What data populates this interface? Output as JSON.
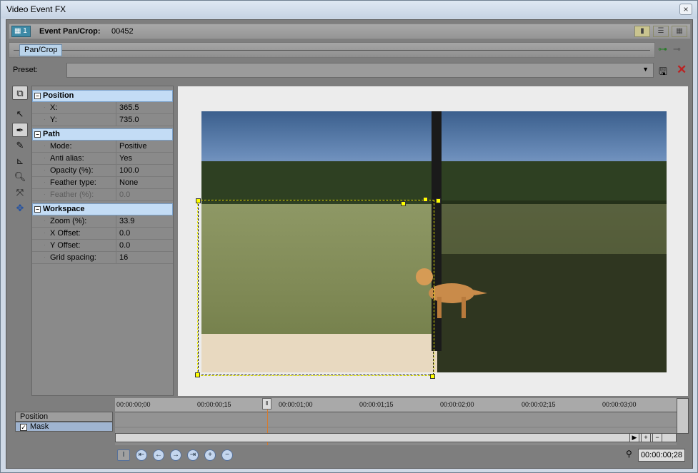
{
  "window": {
    "title": "Video Event FX",
    "close": "×"
  },
  "header": {
    "badge": "1",
    "label": "Event Pan/Crop:",
    "value": "00452",
    "view_icons": [
      "view-single-icon",
      "view-list-icon",
      "view-grid-icon"
    ]
  },
  "chain": {
    "plugin": "Pan/Crop"
  },
  "preset": {
    "label": "Preset:",
    "value": ""
  },
  "tools": [
    "normal-edit-icon",
    "select-icon",
    "anchor-create-icon",
    "anchor-add-icon",
    "anchor-split-icon",
    "zoom-icon",
    "move-icon",
    "pan-icon"
  ],
  "props": {
    "position": {
      "title": "Position",
      "rows": [
        {
          "k": "X:",
          "v": "365.5"
        },
        {
          "k": "Y:",
          "v": "735.0"
        }
      ]
    },
    "path": {
      "title": "Path",
      "rows": [
        {
          "k": "Mode:",
          "v": "Positive"
        },
        {
          "k": "Anti alias:",
          "v": "Yes"
        },
        {
          "k": "Opacity (%):",
          "v": "100.0"
        },
        {
          "k": "Feather type:",
          "v": "None"
        },
        {
          "k": "Feather (%):",
          "v": "0.0"
        }
      ]
    },
    "workspace": {
      "title": "Workspace",
      "rows": [
        {
          "k": "Zoom (%):",
          "v": "33.9"
        },
        {
          "k": "X Offset:",
          "v": "0.0"
        },
        {
          "k": "Y Offset:",
          "v": "0.0"
        },
        {
          "k": "Grid spacing:",
          "v": "16"
        }
      ]
    }
  },
  "timeline": {
    "tracks": [
      {
        "label": "Position"
      },
      {
        "label": "Mask",
        "checked": true
      }
    ],
    "ticks": [
      "00:00:00;00",
      "00:00:00;15",
      "00:00:01;00",
      "00:00:01;15",
      "00:00:02;00",
      "00:00:02;15",
      "00:00:03;00"
    ],
    "timecode": "00:00:00;28"
  },
  "colors": {
    "selection": "#ffff00",
    "accent": "#c3dcf5"
  }
}
